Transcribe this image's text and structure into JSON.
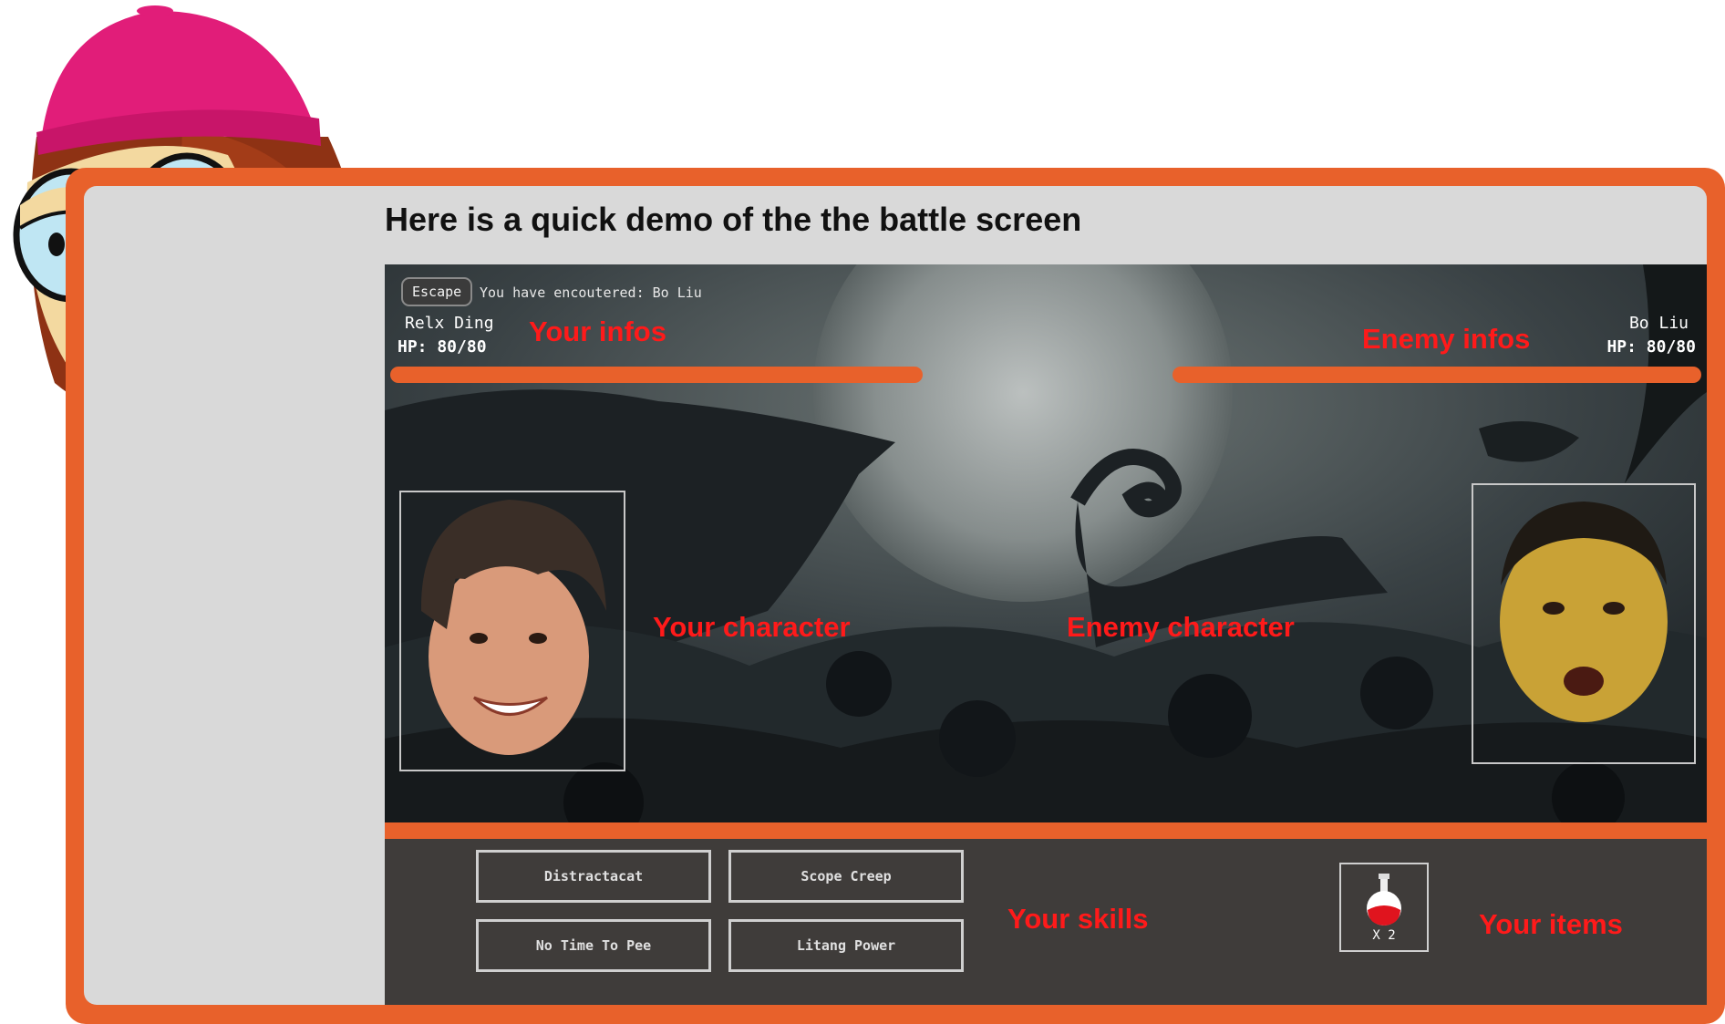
{
  "heading": "Here is a quick demo of the the battle screen",
  "battle": {
    "escape_label": "Escape",
    "encounter_text": "You have encoutered: Bo Liu",
    "player": {
      "name": "Relx Ding",
      "hp": "HP: 80/80"
    },
    "enemy": {
      "name": "Bo Liu",
      "hp": "HP: 80/80"
    },
    "skills": [
      "Distractacat",
      "Scope Creep",
      "No Time To Pee",
      "Litang Power"
    ],
    "item": {
      "icon": "potion-icon",
      "count": "X 2"
    }
  },
  "annotations": {
    "your_infos": "Your infos",
    "enemy_infos": "Enemy infos",
    "your_character": "Your character",
    "enemy_character": "Enemy character",
    "your_skills": "Your skills",
    "your_items": "Your items"
  },
  "colors": {
    "accent": "#e8612b",
    "annotation": "#ff1a1a",
    "panel": "#d9d9d9",
    "bottom_bar": "#3f3c3a"
  }
}
